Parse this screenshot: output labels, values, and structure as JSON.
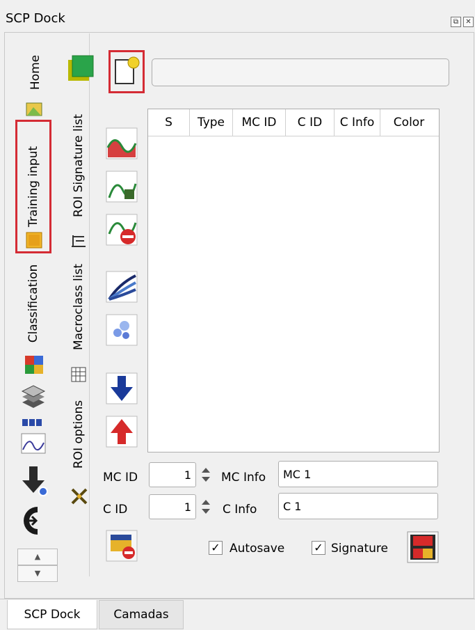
{
  "window": {
    "title": "SCP Dock",
    "restore_icon": "restore-icon",
    "close_icon": "close-icon"
  },
  "left_tabs": [
    "Home",
    "Training input",
    "Classification"
  ],
  "sub_tabs": [
    "ROI Signature list",
    "Macroclass list",
    "ROI options"
  ],
  "top": {
    "path_value": ""
  },
  "table": {
    "columns": [
      "S",
      "Type",
      "MC ID",
      "C ID",
      "C Info",
      "Color"
    ],
    "rows": []
  },
  "form": {
    "mc_id_label": "MC ID",
    "mc_id_value": "1",
    "mc_info_label": "MC Info",
    "mc_info_value": "MC 1",
    "c_id_label": "C ID",
    "c_id_value": "1",
    "c_info_label": "C Info",
    "c_info_value": "C 1"
  },
  "checks": {
    "autosave_label": "Autosave",
    "autosave_checked": true,
    "signature_label": "Signature",
    "signature_checked": true,
    "check_mark": "✓"
  },
  "bottom_tabs": [
    "SCP Dock",
    "Camadas"
  ],
  "colors": {
    "highlight": "#d42b34"
  }
}
